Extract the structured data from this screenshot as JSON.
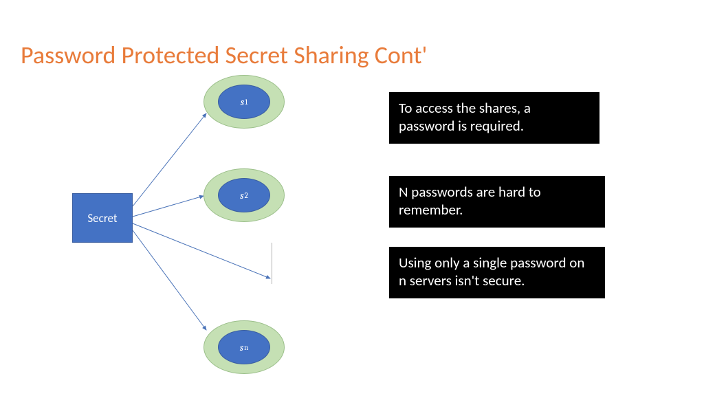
{
  "title": "Password Protected Secret Sharing Cont'",
  "secret_label": "Secret",
  "shares": {
    "s1_base": "s",
    "s1_sub": "1",
    "s2_base": "s",
    "s2_sub": "2",
    "sn_base": "s",
    "sn_sub": "n"
  },
  "callouts": {
    "c1": "To access the shares, a password is required.",
    "c2": "N passwords are hard to remember.",
    "c3": "Using only a single password on n servers isn't secure."
  }
}
